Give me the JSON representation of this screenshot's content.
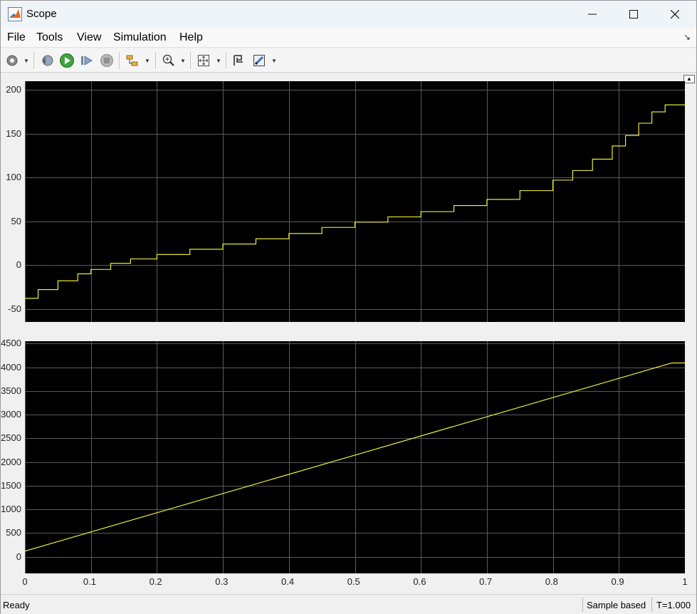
{
  "window": {
    "title": "Scope"
  },
  "menu": {
    "items": [
      "File",
      "Tools",
      "View",
      "Simulation",
      "Help"
    ]
  },
  "toolbar": {
    "icons": [
      "settings-icon",
      "step-back-icon",
      "run-icon",
      "step-forward-icon",
      "stop-icon",
      "signal-select-icon",
      "zoom-in-icon",
      "autoscale-icon",
      "cursor-measure-icon",
      "style-icon"
    ]
  },
  "colors": {
    "plot_bg": "#000000",
    "grid": "#5a5a5a",
    "trace": "#ffff3a"
  },
  "status": {
    "ready": "Ready",
    "sample": "Sample based",
    "time": "T=1.000"
  },
  "chart_data": [
    {
      "type": "line",
      "xlim": [
        0,
        1
      ],
      "ylim": [
        -65,
        210
      ],
      "yticks": [
        -50,
        0,
        50,
        100,
        150,
        200
      ],
      "ytick_labels": [
        "-50",
        "0",
        "50",
        "100",
        "150",
        "200"
      ],
      "grid": true,
      "series": [
        {
          "style": "stairs",
          "x": [
            0,
            0.02,
            0.05,
            0.08,
            0.1,
            0.13,
            0.16,
            0.2,
            0.25,
            0.3,
            0.35,
            0.4,
            0.45,
            0.5,
            0.55,
            0.6,
            0.65,
            0.7,
            0.75,
            0.8,
            0.83,
            0.86,
            0.89,
            0.91,
            0.93,
            0.95,
            0.97,
            0.98,
            1.0
          ],
          "y": [
            -38,
            -28,
            -18,
            -10,
            -5,
            2,
            7,
            12,
            18,
            24,
            30,
            36,
            43,
            49,
            55,
            61,
            68,
            75,
            85,
            97,
            108,
            121,
            136,
            148,
            162,
            175,
            183,
            183,
            183
          ]
        }
      ]
    },
    {
      "type": "line",
      "xlim": [
        0,
        1
      ],
      "ylim": [
        -350,
        4550
      ],
      "yticks": [
        0,
        500,
        1000,
        1500,
        2000,
        2500,
        3000,
        3500,
        4000,
        4500
      ],
      "ytick_labels": [
        "0",
        "500",
        "1000",
        "1500",
        "2000",
        "2500",
        "3000",
        "3500",
        "4000",
        "4500"
      ],
      "xticks": [
        0,
        0.1,
        0.2,
        0.3,
        0.4,
        0.5,
        0.6,
        0.7,
        0.8,
        0.9,
        1
      ],
      "xtick_labels": [
        "0",
        "0.1",
        "0.2",
        "0.3",
        "0.4",
        "0.5",
        "0.6",
        "0.7",
        "0.8",
        "0.9",
        "1"
      ],
      "grid": true,
      "series": [
        {
          "style": "line",
          "x": [
            0,
            0.98,
            1.0
          ],
          "y": [
            120,
            4090,
            4090
          ]
        }
      ]
    }
  ]
}
